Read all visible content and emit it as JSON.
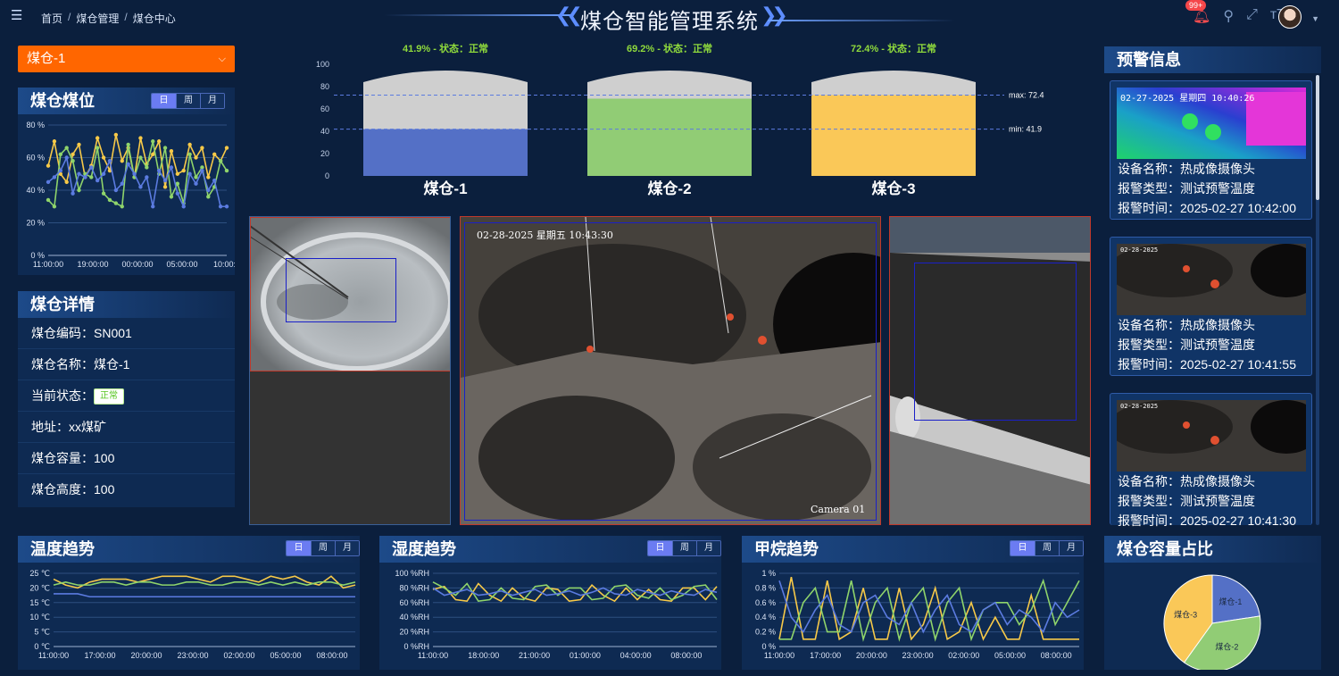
{
  "header": {
    "breadcrumb": [
      "首页",
      "煤仓管理",
      "煤仓中心"
    ],
    "separator": "/",
    "title": "煤仓智能管理系统",
    "notification_badge": "99+",
    "icons": [
      "menu-fold-icon",
      "bell-icon",
      "search-icon",
      "fullscreen-icon",
      "font-size-icon"
    ]
  },
  "silo_select": {
    "value": "煤仓-1"
  },
  "level_panel": {
    "title": "煤仓煤位",
    "segments": [
      "日",
      "周",
      "月"
    ],
    "active": 0
  },
  "level_chart": {
    "type": "line",
    "y_ticks": [
      "80 %",
      "60 %",
      "40 %",
      "20 %",
      "0 %"
    ],
    "x_ticks": [
      "11:00:00",
      "19:00:00",
      "00:00:00",
      "05:00:00",
      "10:00:0"
    ],
    "ylim": [
      0,
      80
    ],
    "series": [
      {
        "color": "#f7c948",
        "values": [
          55,
          70,
          50,
          45,
          62,
          68,
          48,
          55,
          72,
          60,
          52,
          74,
          58,
          66,
          48,
          72,
          56,
          62,
          70,
          42,
          64,
          50,
          52,
          68,
          60,
          66,
          48,
          62,
          58,
          66
        ]
      },
      {
        "color": "#8fd46b",
        "values": [
          34,
          30,
          62,
          66,
          58,
          40,
          50,
          48,
          66,
          38,
          34,
          32,
          30,
          68,
          48,
          60,
          54,
          70,
          50,
          66,
          36,
          44,
          32,
          62,
          48,
          54,
          36,
          42,
          58,
          52
        ]
      },
      {
        "color": "#5b7be0",
        "values": [
          45,
          48,
          52,
          60,
          38,
          50,
          48,
          54,
          46,
          50,
          58,
          40,
          44,
          56,
          50,
          42,
          48,
          30,
          52,
          46,
          54,
          38,
          30,
          50,
          44,
          52,
          40,
          46,
          30,
          30
        ]
      }
    ]
  },
  "details_panel": {
    "title": "煤仓详情",
    "rows": [
      {
        "label": "煤仓编码：",
        "value": "SN001"
      },
      {
        "label": "煤仓名称：",
        "value": "煤仓-1"
      },
      {
        "label": "当前状态：",
        "value": "正常"
      },
      {
        "label": "地址：",
        "value": "xx煤矿"
      },
      {
        "label": "煤仓容量：",
        "value": "100"
      },
      {
        "label": "煤仓高度：",
        "value": "100"
      }
    ]
  },
  "silo_chart": {
    "type": "bar",
    "y_ticks": [
      "100",
      "80",
      "60",
      "40",
      "20",
      "0"
    ],
    "ylim": [
      0,
      100
    ],
    "max_label": "max: 72.4",
    "min_label": "min: 41.9",
    "max": 72.4,
    "min": 41.9,
    "silos": [
      {
        "name": "煤仓-1",
        "value": 41.9,
        "label": "41.9% - 状态：正常",
        "color": "#5470c6"
      },
      {
        "name": "煤仓-2",
        "value": 69.2,
        "label": "69.2% - 状态：正常",
        "color": "#91cc75"
      },
      {
        "name": "煤仓-3",
        "value": 72.4,
        "label": "72.4% - 状态：正常",
        "color": "#fac858"
      }
    ]
  },
  "video": {
    "main_timestamp": "02-28-2025 星期五 10:43:30",
    "main_camera": "Camera 01"
  },
  "alerts": {
    "title": "预警信息",
    "items": [
      {
        "overlay": "02-27-2025 星期四 10:40:26",
        "device_label": "设备名称：",
        "device": "热成像摄像头",
        "type_label": "报警类型：",
        "type": "测试预警温度",
        "time_label": "报警时间：",
        "time": "2025-02-27 10:42:00"
      },
      {
        "overlay": "02-28-2025",
        "device_label": "设备名称：",
        "device": "热成像摄像头",
        "type_label": "报警类型：",
        "type": "测试预警温度",
        "time_label": "报警时间：",
        "time": "2025-02-27 10:41:55"
      },
      {
        "overlay": "02-28-2025",
        "device_label": "设备名称：",
        "device": "热成像摄像头",
        "type_label": "报警类型：",
        "type": "测试预警温度",
        "time_label": "报警时间：",
        "time": "2025-02-27 10:41:30"
      }
    ]
  },
  "bottom": {
    "segments": [
      "日",
      "周",
      "月"
    ],
    "temperature": {
      "title": "温度趋势",
      "y_ticks": [
        "25 ℃",
        "20 ℃",
        "15 ℃",
        "10 ℃",
        "5 ℃",
        "0 ℃"
      ],
      "x_ticks": [
        "11:00:00",
        "17:00:00",
        "20:00:00",
        "23:00:00",
        "02:00:00",
        "05:00:00",
        "08:00:00"
      ],
      "ylim": [
        0,
        25
      ],
      "series": [
        {
          "color": "#f7c948",
          "values": [
            23,
            21,
            20,
            22,
            23,
            23,
            23,
            22,
            23,
            24,
            24,
            24,
            23,
            22,
            24,
            24,
            23,
            22,
            24,
            23,
            24,
            22,
            21,
            24,
            20,
            21
          ]
        },
        {
          "color": "#8fd46b",
          "values": [
            21,
            22,
            21,
            21,
            22,
            22,
            21,
            22,
            22,
            21,
            21,
            22,
            22,
            21,
            21,
            22,
            22,
            21,
            22,
            21,
            22,
            21,
            22,
            22,
            21,
            22
          ]
        },
        {
          "color": "#5b7be0",
          "values": [
            18,
            18,
            18,
            17,
            17,
            17,
            17,
            17,
            17,
            17,
            17,
            17,
            17,
            17,
            17,
            17,
            17,
            17,
            17,
            17,
            17,
            17,
            17,
            17,
            17,
            17
          ]
        }
      ]
    },
    "humidity": {
      "title": "湿度趋势",
      "y_ticks": [
        "100 %RH",
        "80 %RH",
        "60 %RH",
        "40 %RH",
        "20 %RH",
        "0 %RH"
      ],
      "x_ticks": [
        "11:00:00",
        "18:00:00",
        "21:00:00",
        "01:00:00",
        "04:00:00",
        "08:00:00"
      ],
      "ylim": [
        0,
        100
      ],
      "series": [
        {
          "color": "#f7c948",
          "values": [
            78,
            82,
            64,
            62,
            86,
            70,
            62,
            80,
            66,
            62,
            80,
            78,
            62,
            64,
            84,
            70,
            62,
            80,
            64,
            78,
            64,
            62,
            80,
            80,
            64,
            82
          ]
        },
        {
          "color": "#8fd46b",
          "values": [
            88,
            80,
            70,
            86,
            62,
            64,
            80,
            66,
            64,
            82,
            84,
            70,
            80,
            80,
            64,
            66,
            82,
            84,
            70,
            66,
            80,
            64,
            70,
            82,
            84,
            64
          ]
        },
        {
          "color": "#5b7be0",
          "values": [
            80,
            70,
            74,
            78,
            70,
            72,
            76,
            70,
            74,
            78,
            70,
            72,
            76,
            70,
            74,
            80,
            72,
            70,
            78,
            74,
            70,
            76,
            72,
            70,
            78,
            74
          ]
        }
      ]
    },
    "methane": {
      "title": "甲烷趋势",
      "y_ticks": [
        "1 %",
        "0.8 %",
        "0.6 %",
        "0.4 %",
        "0.2 %",
        "0 %"
      ],
      "x_ticks": [
        "11:00:00",
        "17:00:00",
        "20:00:00",
        "23:00:00",
        "02:00:00",
        "05:00:00",
        "08:00:00"
      ],
      "ylim": [
        0,
        1
      ],
      "series": [
        {
          "color": "#f7c948",
          "values": [
            0.1,
            0.95,
            0.1,
            0.1,
            0.9,
            0.1,
            0.2,
            0.8,
            0.1,
            0.1,
            0.8,
            0.1,
            0.3,
            0.8,
            0.1,
            0.2,
            0.6,
            0.1,
            0.4,
            0.1,
            0.1,
            0.7,
            0.1,
            0.1,
            0.1,
            0.1
          ]
        },
        {
          "color": "#8fd46b",
          "values": [
            0.1,
            0.1,
            0.6,
            0.8,
            0.2,
            0.2,
            0.9,
            0.1,
            0.6,
            0.8,
            0.1,
            0.6,
            0.8,
            0.1,
            0.6,
            0.8,
            0.1,
            0.5,
            0.6,
            0.6,
            0.3,
            0.5,
            0.9,
            0.3,
            0.6,
            0.9
          ]
        },
        {
          "color": "#5b7be0",
          "values": [
            0.9,
            0.4,
            0.2,
            0.5,
            0.7,
            0.3,
            0.2,
            0.6,
            0.7,
            0.4,
            0.3,
            0.6,
            0.2,
            0.5,
            0.7,
            0.3,
            0.2,
            0.5,
            0.6,
            0.3,
            0.5,
            0.4,
            0.2,
            0.6,
            0.4,
            0.5
          ]
        }
      ]
    },
    "capacity": {
      "title": "煤仓容量占比",
      "type": "pie",
      "slices": [
        {
          "name": "煤仓-1",
          "value": 22.6,
          "color": "#5470c6"
        },
        {
          "name": "煤仓-2",
          "value": 37.3,
          "color": "#91cc75"
        },
        {
          "name": "煤仓-3",
          "value": 40.1,
          "color": "#fac858"
        }
      ]
    }
  }
}
